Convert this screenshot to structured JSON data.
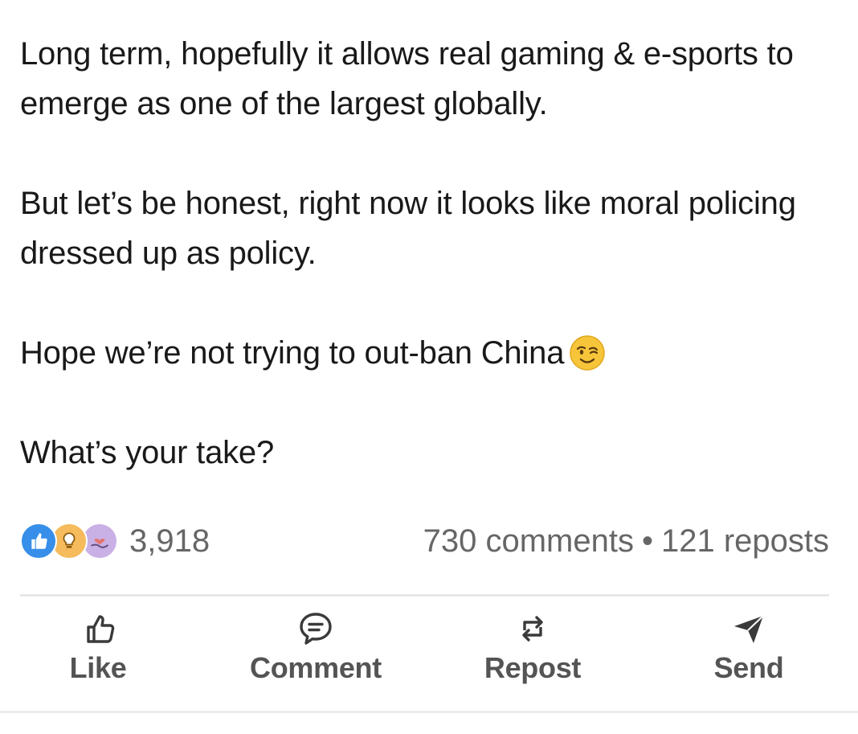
{
  "post": {
    "paragraphs": [
      "Long term, hopefully it allows real gaming & e-sports to emerge as one of the largest globally.",
      "But let’s be honest, right now it looks like moral policing dressed up as policy.",
      "Hope we’re not trying to out-ban China",
      "What’s your take?"
    ],
    "emoji": "winking-face-emoji"
  },
  "social": {
    "reaction_count": "3,918",
    "comments": "730 comments",
    "separator": "•",
    "reposts": "121 reposts",
    "reaction_icons": [
      "like-reaction-icon",
      "insightful-reaction-icon",
      "support-reaction-icon"
    ]
  },
  "actions": {
    "like": "Like",
    "comment": "Comment",
    "repost": "Repost",
    "send": "Send"
  },
  "colors": {
    "text": "#191919",
    "muted": "#666666",
    "action": "#545454",
    "like_blue": "#378fe9",
    "insight_yellow": "#f5bb5c",
    "support_purple": "#c9b1e6"
  }
}
